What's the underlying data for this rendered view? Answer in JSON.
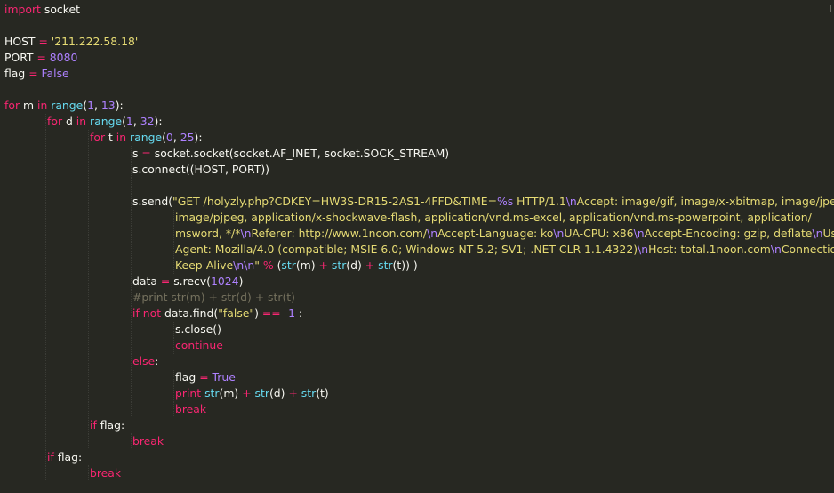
{
  "editor": {
    "language": "python",
    "colors": {
      "background": "#272822",
      "plain": "#f8f8f2",
      "keyword": "#f92672",
      "builtin": "#66d9ef",
      "number": "#ae81ff",
      "string": "#e6db74",
      "comment": "#75715e"
    },
    "lines": [
      {
        "indent": 0,
        "tokens": [
          [
            "kw",
            "import"
          ],
          [
            "plain",
            " socket"
          ]
        ]
      },
      {
        "indent": 0,
        "tokens": []
      },
      {
        "indent": 0,
        "tokens": [
          [
            "plain",
            "HOST "
          ],
          [
            "kw",
            "="
          ],
          [
            "plain",
            " "
          ],
          [
            "str",
            "'211.222.58.18'"
          ]
        ]
      },
      {
        "indent": 0,
        "tokens": [
          [
            "plain",
            "PORT "
          ],
          [
            "kw",
            "="
          ],
          [
            "plain",
            " "
          ],
          [
            "num",
            "8080"
          ]
        ]
      },
      {
        "indent": 0,
        "tokens": [
          [
            "plain",
            "flag "
          ],
          [
            "kw",
            "="
          ],
          [
            "plain",
            " "
          ],
          [
            "num",
            "False"
          ]
        ]
      },
      {
        "indent": 0,
        "tokens": []
      },
      {
        "indent": 0,
        "tokens": [
          [
            "kw",
            "for"
          ],
          [
            "plain",
            " m "
          ],
          [
            "kw",
            "in"
          ],
          [
            "plain",
            " "
          ],
          [
            "bi",
            "range"
          ],
          [
            "plain",
            "("
          ],
          [
            "num",
            "1"
          ],
          [
            "plain",
            ", "
          ],
          [
            "num",
            "13"
          ],
          [
            "plain",
            "):"
          ]
        ]
      },
      {
        "indent": 1,
        "tokens": [
          [
            "kw",
            "for"
          ],
          [
            "plain",
            " d "
          ],
          [
            "kw",
            "in"
          ],
          [
            "plain",
            " "
          ],
          [
            "bi",
            "range"
          ],
          [
            "plain",
            "("
          ],
          [
            "num",
            "1"
          ],
          [
            "plain",
            ", "
          ],
          [
            "num",
            "32"
          ],
          [
            "plain",
            "):"
          ]
        ]
      },
      {
        "indent": 2,
        "tokens": [
          [
            "kw",
            "for"
          ],
          [
            "plain",
            " t "
          ],
          [
            "kw",
            "in"
          ],
          [
            "plain",
            " "
          ],
          [
            "bi",
            "range"
          ],
          [
            "plain",
            "("
          ],
          [
            "num",
            "0"
          ],
          [
            "plain",
            ", "
          ],
          [
            "num",
            "25"
          ],
          [
            "plain",
            "):"
          ]
        ]
      },
      {
        "indent": 3,
        "tokens": [
          [
            "plain",
            "s "
          ],
          [
            "kw",
            "="
          ],
          [
            "plain",
            " socket.socket(socket.AF_INET, socket.SOCK_STREAM)"
          ]
        ]
      },
      {
        "indent": 3,
        "tokens": [
          [
            "plain",
            "s.connect((HOST, PORT))"
          ]
        ]
      },
      {
        "indent": 3,
        "tokens": []
      },
      {
        "indent": 3,
        "tokens": [
          [
            "plain",
            "s.send("
          ],
          [
            "str",
            "\"GET /holyzly.php?CDKEY=HW3S-DR15-2AS1-4FFD&TIME="
          ],
          [
            "num",
            "%s"
          ],
          [
            "str",
            " HTTP/1.1"
          ],
          [
            "num",
            "\\n"
          ],
          [
            "str",
            "Accept: image/gif, image/x-xbitmap, image/jpeg,"
          ]
        ]
      },
      {
        "indent": 4,
        "tokens": [
          [
            "str",
            "image/pjpeg, application/x-shockwave-flash, application/vnd.ms-excel, application/vnd.ms-powerpoint, application/"
          ]
        ]
      },
      {
        "indent": 4,
        "tokens": [
          [
            "str",
            "msword, */*"
          ],
          [
            "num",
            "\\n"
          ],
          [
            "str",
            "Referer: http://www.1noon.com/"
          ],
          [
            "num",
            "\\n"
          ],
          [
            "str",
            "Accept-Language: ko"
          ],
          [
            "num",
            "\\n"
          ],
          [
            "str",
            "UA-CPU: x86"
          ],
          [
            "num",
            "\\n"
          ],
          [
            "str",
            "Accept-Encoding: gzip, deflate"
          ],
          [
            "num",
            "\\n"
          ],
          [
            "str",
            "User-"
          ]
        ]
      },
      {
        "indent": 4,
        "tokens": [
          [
            "str",
            "Agent: Mozilla/4.0 (compatible; MSIE 6.0; Windows NT 5.2; SV1; .NET CLR 1.1.4322)"
          ],
          [
            "num",
            "\\n"
          ],
          [
            "str",
            "Host: total.1noon.com"
          ],
          [
            "num",
            "\\n"
          ],
          [
            "str",
            "Connection:"
          ]
        ]
      },
      {
        "indent": 4,
        "tokens": [
          [
            "str",
            "Keep-Alive"
          ],
          [
            "num",
            "\\n\\n"
          ],
          [
            "str",
            "\""
          ],
          [
            "plain",
            " "
          ],
          [
            "kw",
            "%"
          ],
          [
            "plain",
            " ("
          ],
          [
            "bi",
            "str"
          ],
          [
            "plain",
            "(m) "
          ],
          [
            "kw",
            "+"
          ],
          [
            "plain",
            " "
          ],
          [
            "bi",
            "str"
          ],
          [
            "plain",
            "(d) "
          ],
          [
            "kw",
            "+"
          ],
          [
            "plain",
            " "
          ],
          [
            "bi",
            "str"
          ],
          [
            "plain",
            "(t)) )"
          ]
        ]
      },
      {
        "indent": 3,
        "tokens": [
          [
            "plain",
            "data "
          ],
          [
            "kw",
            "="
          ],
          [
            "plain",
            " s.recv("
          ],
          [
            "num",
            "1024"
          ],
          [
            "plain",
            ")"
          ]
        ]
      },
      {
        "indent": 3,
        "tokens": [
          [
            "cmt",
            "#print str(m) + str(d) + str(t)"
          ]
        ]
      },
      {
        "indent": 3,
        "tokens": [
          [
            "kw",
            "if"
          ],
          [
            "plain",
            " "
          ],
          [
            "kw",
            "not"
          ],
          [
            "plain",
            " data.find("
          ],
          [
            "str",
            "\"false\""
          ],
          [
            "plain",
            ") "
          ],
          [
            "kw",
            "=="
          ],
          [
            "plain",
            " "
          ],
          [
            "kw",
            "-"
          ],
          [
            "num",
            "1"
          ],
          [
            "plain",
            " :"
          ]
        ]
      },
      {
        "indent": 4,
        "tokens": [
          [
            "plain",
            "s.close()"
          ]
        ]
      },
      {
        "indent": 4,
        "tokens": [
          [
            "kw",
            "continue"
          ]
        ]
      },
      {
        "indent": 3,
        "tokens": [
          [
            "kw",
            "else"
          ],
          [
            "plain",
            ":"
          ]
        ]
      },
      {
        "indent": 4,
        "tokens": [
          [
            "plain",
            "flag "
          ],
          [
            "kw",
            "="
          ],
          [
            "plain",
            " "
          ],
          [
            "num",
            "True"
          ]
        ]
      },
      {
        "indent": 4,
        "tokens": [
          [
            "kw",
            "print"
          ],
          [
            "plain",
            " "
          ],
          [
            "bi",
            "str"
          ],
          [
            "plain",
            "(m) "
          ],
          [
            "kw",
            "+"
          ],
          [
            "plain",
            " "
          ],
          [
            "bi",
            "str"
          ],
          [
            "plain",
            "(d) "
          ],
          [
            "kw",
            "+"
          ],
          [
            "plain",
            " "
          ],
          [
            "bi",
            "str"
          ],
          [
            "plain",
            "(t)"
          ]
        ]
      },
      {
        "indent": 4,
        "tokens": [
          [
            "kw",
            "break"
          ]
        ]
      },
      {
        "indent": 2,
        "tokens": [
          [
            "kw",
            "if"
          ],
          [
            "plain",
            " flag:"
          ]
        ]
      },
      {
        "indent": 3,
        "tokens": [
          [
            "kw",
            "break"
          ]
        ]
      },
      {
        "indent": 1,
        "tokens": [
          [
            "kw",
            "if"
          ],
          [
            "plain",
            " flag:"
          ]
        ]
      },
      {
        "indent": 2,
        "tokens": [
          [
            "kw",
            "break"
          ]
        ]
      }
    ]
  }
}
